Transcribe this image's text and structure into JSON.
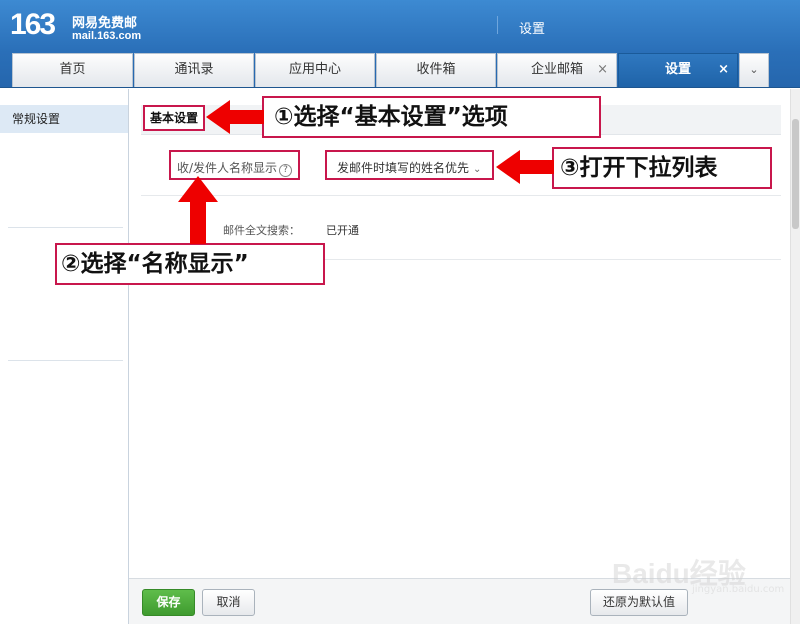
{
  "header": {
    "logo_number": "163",
    "logo_slogan": "网易免费邮",
    "logo_domain": "mail.163.com",
    "title": "设置"
  },
  "tabs": [
    {
      "label": "首页",
      "closable": false,
      "active": false
    },
    {
      "label": "通讯录",
      "closable": false,
      "active": false
    },
    {
      "label": "应用中心",
      "closable": false,
      "active": false
    },
    {
      "label": "收件箱",
      "closable": false,
      "active": false
    },
    {
      "label": "企业邮箱",
      "closable": true,
      "active": false
    },
    {
      "label": "设置",
      "closable": true,
      "active": true
    }
  ],
  "tab_close_glyph": "×",
  "tab_more_glyph": "⌄",
  "sidebar": {
    "items": [
      {
        "label": "常规设置",
        "active": true
      }
    ]
  },
  "main": {
    "section_title": "基本设置",
    "name_display_label": "收/发件人名称显示",
    "help_glyph": "?",
    "name_display_value": "发邮件时填写的姓名优先",
    "chevron_glyph": "⌄",
    "search_label": "邮件全文搜索：",
    "search_value": "已开通"
  },
  "footer": {
    "save_label": "保存",
    "cancel_label": "取消",
    "reset_label": "还原为默认值"
  },
  "annotations": {
    "step1": "①选择“基本设置”选项",
    "step2": "②选择“名称显示”",
    "step3": "③打开下拉列表",
    "color": "#c8174c",
    "arrow_color": "#ee0000"
  },
  "watermark": {
    "text": "Baidu经验",
    "sub": "jingyan.baidu.com"
  },
  "colors": {
    "header_blue": "#2a6fb8",
    "active_tab": "#1f63a8",
    "save_green": "#3f9b2f",
    "sidebar_active": "#dde9f5"
  }
}
